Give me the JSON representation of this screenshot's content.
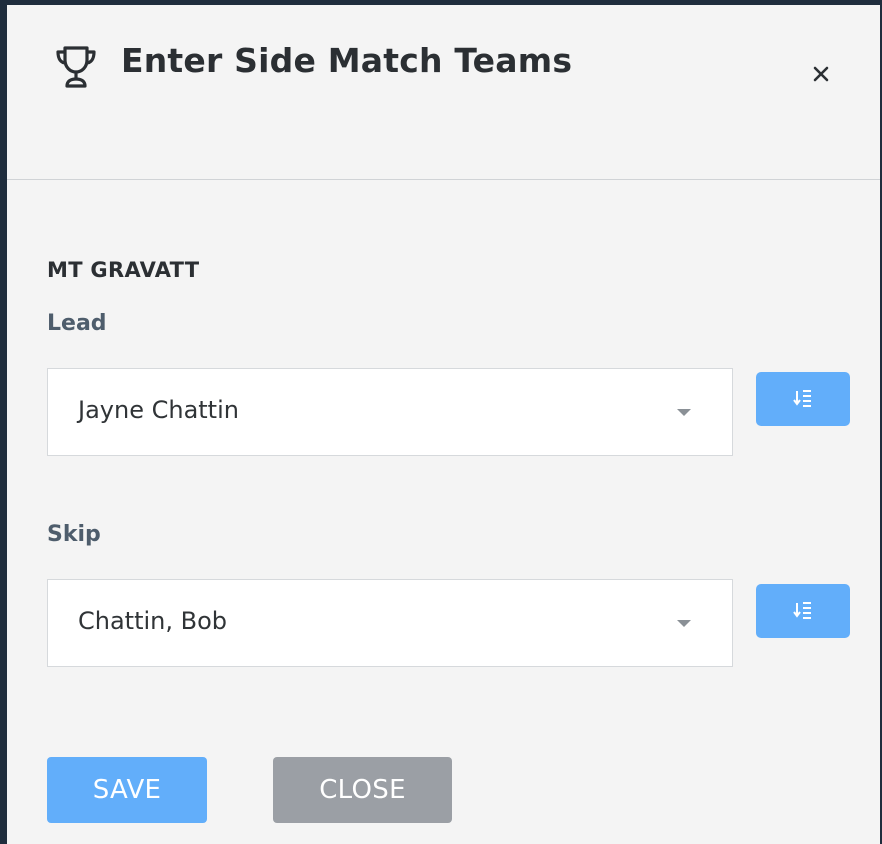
{
  "dialog": {
    "title": "Enter Side Match Teams",
    "title_icon": "trophy-icon",
    "close_icon": "close-icon"
  },
  "team": {
    "name": "MT GRAVATT",
    "positions": [
      {
        "label": "Lead",
        "selected": "Jayne Chattin",
        "sort_icon": "sort-list-icon"
      },
      {
        "label": "Skip",
        "selected": "Chattin, Bob",
        "sort_icon": "sort-list-icon"
      }
    ]
  },
  "actions": {
    "save_label": "SAVE",
    "close_label": "CLOSE"
  },
  "colors": {
    "primary": "#62aefa",
    "secondary": "#9b9fa5",
    "text": "#2b2f33",
    "label": "#4e5d6c",
    "frame": "#1f2d3d"
  }
}
